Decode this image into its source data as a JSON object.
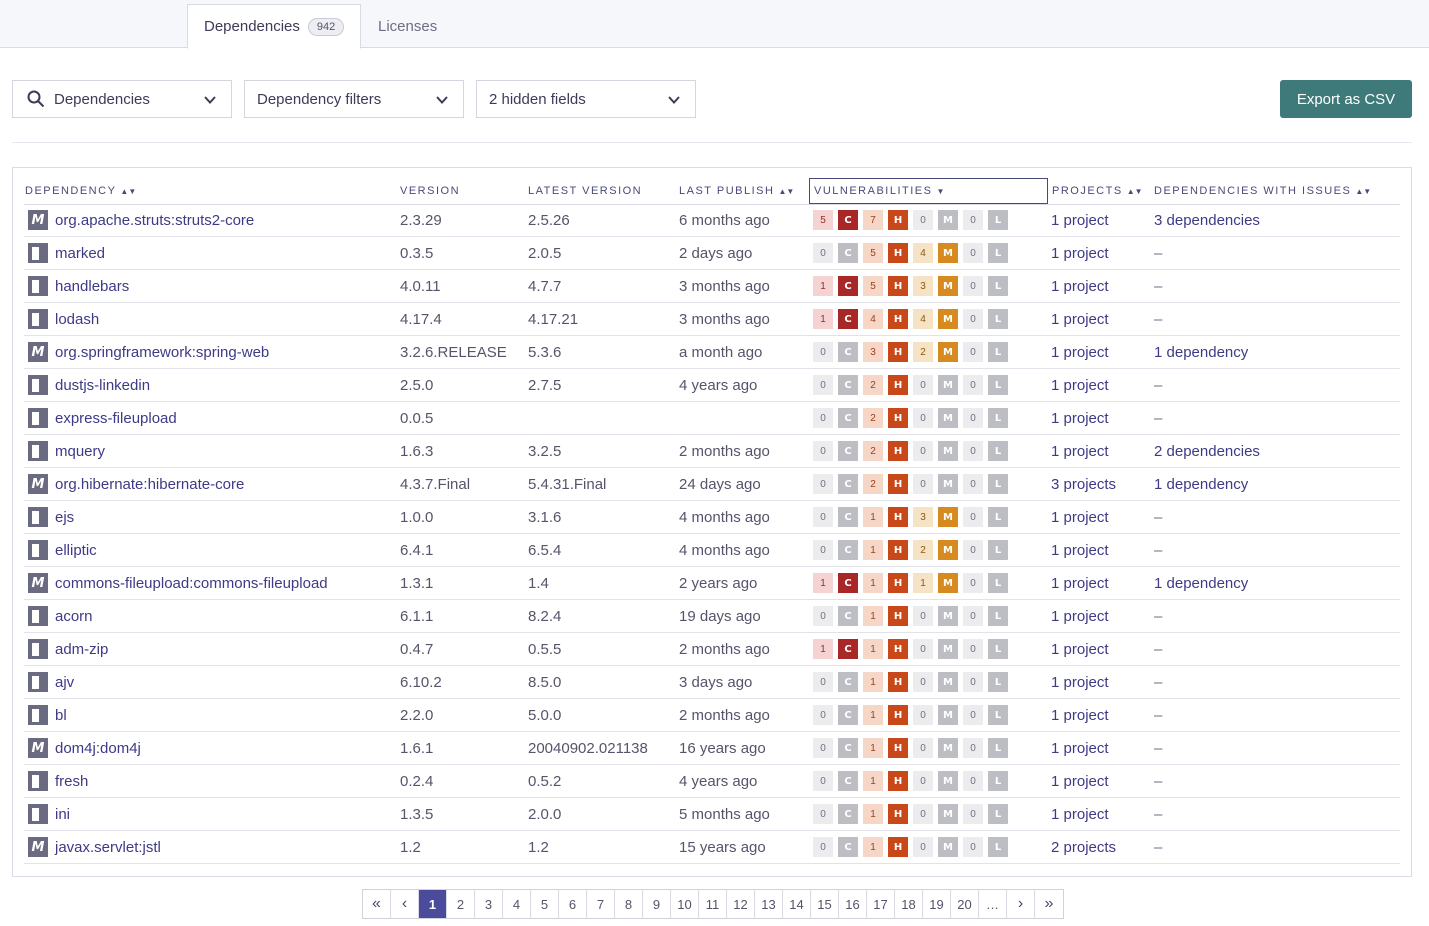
{
  "tabs": [
    {
      "label": "Dependencies",
      "count": "942"
    },
    {
      "label": "Licenses"
    }
  ],
  "toolbar": {
    "dependencies_dropdown": "Dependencies",
    "filters_dropdown": "Dependency filters",
    "hidden_fields_dropdown": "2 hidden fields",
    "export_label": "Export as CSV"
  },
  "columns": {
    "dependency": "Dependency",
    "version": "Version",
    "latest_version": "Latest version",
    "last_publish": "Last publish",
    "vulnerabilities": "Vulnerabilities",
    "projects": "Projects",
    "dependencies_with_issues": "Dependencies with issues"
  },
  "severity_letters": [
    "C",
    "H",
    "M",
    "L"
  ],
  "rows": [
    {
      "type": "maven",
      "name": "org.apache.struts:struts2-core",
      "version": "2.3.29",
      "latest": "2.5.26",
      "published": "6 months ago",
      "vulns": [
        "5",
        "7",
        "0",
        "0"
      ],
      "projects": "1 project",
      "issues": "3 dependencies"
    },
    {
      "type": "npm",
      "name": "marked",
      "version": "0.3.5",
      "latest": "2.0.5",
      "published": "2 days ago",
      "vulns": [
        "0",
        "5",
        "4",
        "0"
      ],
      "projects": "1 project",
      "issues": "–"
    },
    {
      "type": "npm",
      "name": "handlebars",
      "version": "4.0.11",
      "latest": "4.7.7",
      "published": "3 months ago",
      "vulns": [
        "1",
        "5",
        "3",
        "0"
      ],
      "projects": "1 project",
      "issues": "–"
    },
    {
      "type": "npm",
      "name": "lodash",
      "version": "4.17.4",
      "latest": "4.17.21",
      "published": "3 months ago",
      "vulns": [
        "1",
        "4",
        "4",
        "0"
      ],
      "projects": "1 project",
      "issues": "–"
    },
    {
      "type": "maven",
      "name": "org.springframework:spring-web",
      "version": "3.2.6.RELEASE",
      "latest": "5.3.6",
      "published": "a month ago",
      "vulns": [
        "0",
        "3",
        "2",
        "0"
      ],
      "projects": "1 project",
      "issues": "1 dependency"
    },
    {
      "type": "npm",
      "name": "dustjs-linkedin",
      "version": "2.5.0",
      "latest": "2.7.5",
      "published": "4 years ago",
      "vulns": [
        "0",
        "2",
        "0",
        "0"
      ],
      "projects": "1 project",
      "issues": "–"
    },
    {
      "type": "npm",
      "name": "express-fileupload",
      "version": "0.0.5",
      "latest": "",
      "published": "",
      "vulns": [
        "0",
        "2",
        "0",
        "0"
      ],
      "projects": "1 project",
      "issues": "–"
    },
    {
      "type": "npm",
      "name": "mquery",
      "version": "1.6.3",
      "latest": "3.2.5",
      "published": "2 months ago",
      "vulns": [
        "0",
        "2",
        "0",
        "0"
      ],
      "projects": "1 project",
      "issues": "2 dependencies"
    },
    {
      "type": "maven",
      "name": "org.hibernate:hibernate-core",
      "version": "4.3.7.Final",
      "latest": "5.4.31.Final",
      "published": "24 days ago",
      "vulns": [
        "0",
        "2",
        "0",
        "0"
      ],
      "projects": "3 projects",
      "issues": "1 dependency"
    },
    {
      "type": "npm",
      "name": "ejs",
      "version": "1.0.0",
      "latest": "3.1.6",
      "published": "4 months ago",
      "vulns": [
        "0",
        "1",
        "3",
        "0"
      ],
      "projects": "1 project",
      "issues": "–"
    },
    {
      "type": "npm",
      "name": "elliptic",
      "version": "6.4.1",
      "latest": "6.5.4",
      "published": "4 months ago",
      "vulns": [
        "0",
        "1",
        "2",
        "0"
      ],
      "projects": "1 project",
      "issues": "–"
    },
    {
      "type": "maven",
      "name": "commons-fileupload:commons-fileupload",
      "version": "1.3.1",
      "latest": "1.4",
      "published": "2 years ago",
      "vulns": [
        "1",
        "1",
        "1",
        "0"
      ],
      "projects": "1 project",
      "issues": "1 dependency"
    },
    {
      "type": "npm",
      "name": "acorn",
      "version": "6.1.1",
      "latest": "8.2.4",
      "published": "19 days ago",
      "vulns": [
        "0",
        "1",
        "0",
        "0"
      ],
      "projects": "1 project",
      "issues": "–"
    },
    {
      "type": "npm",
      "name": "adm-zip",
      "version": "0.4.7",
      "latest": "0.5.5",
      "published": "2 months ago",
      "vulns": [
        "1",
        "1",
        "0",
        "0"
      ],
      "projects": "1 project",
      "issues": "–"
    },
    {
      "type": "npm",
      "name": "ajv",
      "version": "6.10.2",
      "latest": "8.5.0",
      "published": "3 days ago",
      "vulns": [
        "0",
        "1",
        "0",
        "0"
      ],
      "projects": "1 project",
      "issues": "–"
    },
    {
      "type": "npm",
      "name": "bl",
      "version": "2.2.0",
      "latest": "5.0.0",
      "published": "2 months ago",
      "vulns": [
        "0",
        "1",
        "0",
        "0"
      ],
      "projects": "1 project",
      "issues": "–"
    },
    {
      "type": "maven",
      "name": "dom4j:dom4j",
      "version": "1.6.1",
      "latest": "20040902.021138",
      "published": "16 years ago",
      "vulns": [
        "0",
        "1",
        "0",
        "0"
      ],
      "projects": "1 project",
      "issues": "–"
    },
    {
      "type": "npm",
      "name": "fresh",
      "version": "0.2.4",
      "latest": "0.5.2",
      "published": "4 years ago",
      "vulns": [
        "0",
        "1",
        "0",
        "0"
      ],
      "projects": "1 project",
      "issues": "–"
    },
    {
      "type": "npm",
      "name": "ini",
      "version": "1.3.5",
      "latest": "2.0.0",
      "published": "5 months ago",
      "vulns": [
        "0",
        "1",
        "0",
        "0"
      ],
      "projects": "1 project",
      "issues": "–"
    },
    {
      "type": "maven",
      "name": "javax.servlet:jstl",
      "version": "1.2",
      "latest": "1.2",
      "published": "15 years ago",
      "vulns": [
        "0",
        "1",
        "0",
        "0"
      ],
      "projects": "2 projects",
      "issues": "–"
    }
  ],
  "pagination": {
    "first": "«",
    "prev": "‹",
    "pages": [
      "1",
      "2",
      "3",
      "4",
      "5",
      "6",
      "7",
      "8",
      "9",
      "10",
      "11",
      "12",
      "13",
      "14",
      "15",
      "16",
      "17",
      "18",
      "19",
      "20",
      "…"
    ],
    "current": "1",
    "next": "›",
    "last": "»"
  },
  "icons": {
    "search": "search-icon",
    "chevron": "chevron-down-icon",
    "maven": "maven-package-icon",
    "npm": "npm-package-icon"
  }
}
